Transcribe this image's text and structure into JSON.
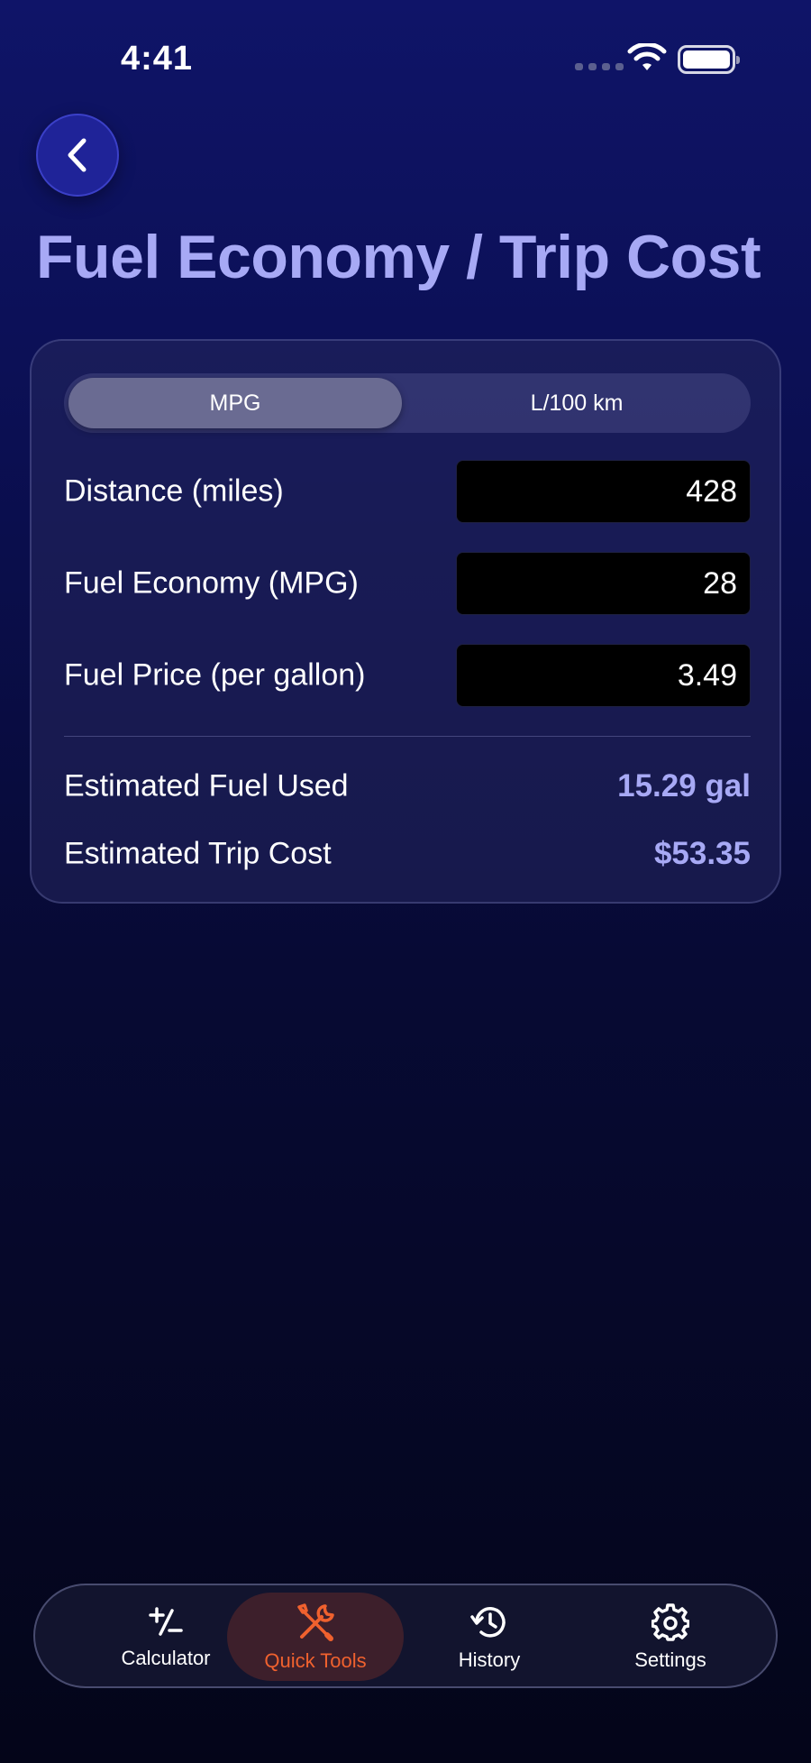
{
  "status_bar": {
    "time": "4:41"
  },
  "header": {
    "title": "Fuel Economy / Trip Cost"
  },
  "segmented_control": {
    "options": [
      "MPG",
      "L/100 km"
    ],
    "selected": "MPG"
  },
  "inputs": [
    {
      "label": "Distance (miles)",
      "value": "428"
    },
    {
      "label": "Fuel Economy (MPG)",
      "value": "28"
    },
    {
      "label": "Fuel Price (per gallon)",
      "value": "3.49"
    }
  ],
  "results": [
    {
      "label": "Estimated Fuel Used",
      "value": "15.29 gal"
    },
    {
      "label": "Estimated Trip Cost",
      "value": "$53.35"
    }
  ],
  "tab_bar": {
    "tabs": [
      {
        "label": "Calculator",
        "icon": "plus-minus-icon"
      },
      {
        "label": "Quick Tools",
        "icon": "tools-icon"
      },
      {
        "label": "History",
        "icon": "history-icon"
      },
      {
        "label": "Settings",
        "icon": "gear-icon"
      }
    ],
    "active": "Quick Tools"
  },
  "colors": {
    "accent": "#a7a9f5",
    "active_tab": "#f0612e",
    "button_bg": "#1f2398"
  }
}
